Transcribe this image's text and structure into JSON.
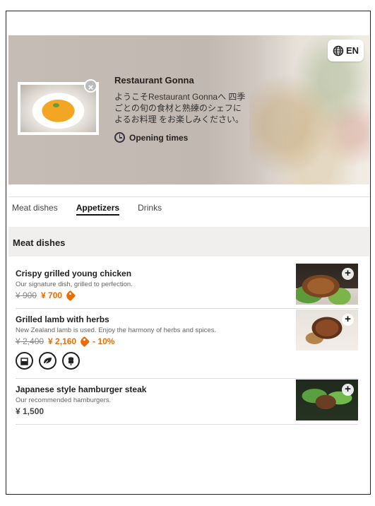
{
  "hero": {
    "lang_label": "EN",
    "restaurant_name": "Restaurant Gonna",
    "description": "ようこそRestaurant Gonnaへ 四季ごとの旬の食材と熟練のシェフによるお料理 をお楽しみください。",
    "opening_label": "Opening times"
  },
  "tabs": [
    {
      "label": "Meat dishes",
      "active": false
    },
    {
      "label": "Appetizers",
      "active": true
    },
    {
      "label": "Drinks",
      "active": false
    }
  ],
  "section": {
    "title": "Meat dishes"
  },
  "items": [
    {
      "name": "Crispy grilled young chicken",
      "desc": "Our signature dish, grilled to perfection.",
      "old_price": "¥ 900",
      "price": "¥ 700",
      "discount": "",
      "tag": true
    },
    {
      "name": "Grilled lamb with herbs",
      "desc": "New Zealand lamb is used. Enjoy the harmony of herbs and spices.",
      "old_price": "¥ 2,400",
      "price": "¥ 2,160",
      "discount": "- 10%",
      "tag": true,
      "allergens": [
        "milk-icon",
        "vegan-leaf-icon",
        "wheat-icon"
      ]
    },
    {
      "name": "Japanese style hamburger steak",
      "desc": "Our recommended hamburgers.",
      "price": "¥ 1,500"
    }
  ],
  "colors": {
    "accent": "#ef6c00",
    "section_bg": "#f0efed"
  }
}
